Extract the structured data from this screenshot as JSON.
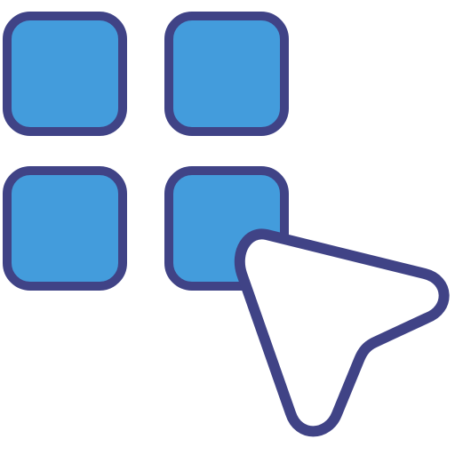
{
  "icon": {
    "name": "app-grid-select-icon",
    "parts": [
      {
        "name": "grid-tile-top-left-icon"
      },
      {
        "name": "grid-tile-top-right-icon"
      },
      {
        "name": "grid-tile-bottom-left-icon"
      },
      {
        "name": "grid-tile-bottom-right-icon"
      },
      {
        "name": "cursor-arrow-icon"
      }
    ]
  },
  "colors": {
    "tile_fill": "#439CDC",
    "outline": "#404386",
    "cursor_fill": "#FFFFFF",
    "background": "#FFFFFF"
  }
}
